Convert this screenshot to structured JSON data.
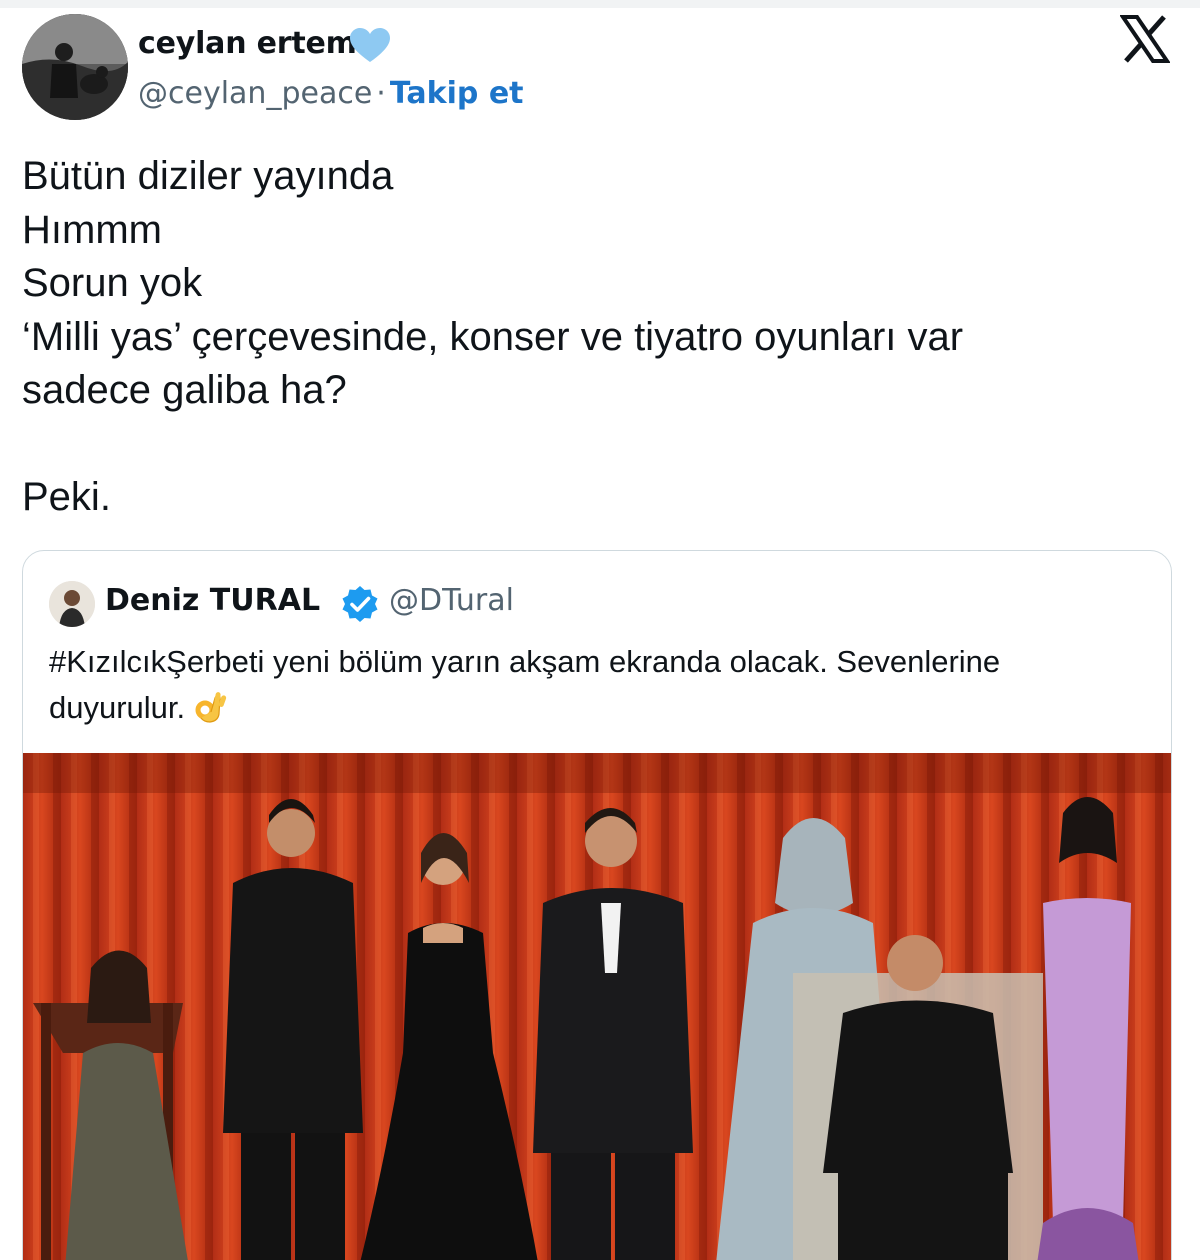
{
  "author": {
    "display_name": "ceylan ertem",
    "handle": "@ceylan_peace",
    "separator": "·",
    "follow_label": "Takip et",
    "badge_color": "#8ec9f2"
  },
  "platform_logo": "x-logo",
  "tweet": {
    "lines": [
      "Bütün diziler yayında",
      "Hımmm",
      "Sorun yok",
      "‘Milli yas’ çerçevesinde, konser ve tiyatro oyunları var",
      "sadece galiba ha?",
      "",
      "Peki."
    ]
  },
  "quoted_tweet": {
    "display_name": "Deniz TURAL",
    "handle": "@DTural",
    "verified_color": "#1d9bf0",
    "text_lines": [
      "#KızılcıkŞerbeti yeni bölüm yarın akşam ekranda olacak. Sevenlerine",
      "duyurulur."
    ],
    "emoji": "ok-hand-icon",
    "image": "cast-photo"
  },
  "colors": {
    "link": "#1d75c9",
    "muted": "#536471",
    "border": "#cfd9de",
    "curtain": "#c8361a"
  }
}
